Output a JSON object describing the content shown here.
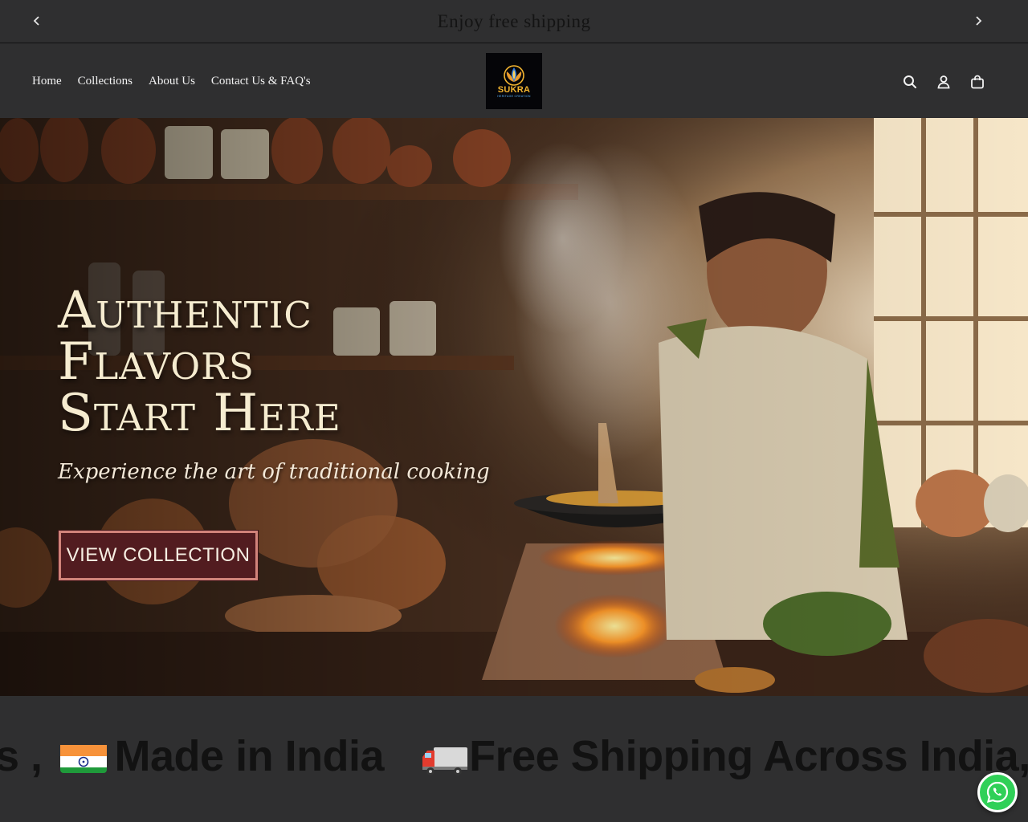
{
  "announcement": {
    "message": "Enjoy free shipping",
    "prev_icon": "chevron-left-icon",
    "next_icon": "chevron-right-icon"
  },
  "header": {
    "nav": [
      {
        "label": "Home"
      },
      {
        "label": "Collections"
      },
      {
        "label": "About Us"
      },
      {
        "label": "Contact Us & FAQ's"
      }
    ],
    "logo": {
      "brand": "SUKRA",
      "tagline": "HERITAGE CREATION"
    },
    "icons": [
      "search-icon",
      "account-icon",
      "cart-icon"
    ]
  },
  "hero": {
    "headline_line1": "Authentic",
    "headline_line2": "Flavors",
    "headline_line3": "Start Here",
    "subheadline": "Experience the art of traditional cooking",
    "cta_label": "VIEW COLLECTION"
  },
  "marquee": {
    "lead_text": "s ,",
    "item1": "Made in India",
    "item2": "Free Shipping Across India,"
  },
  "colors": {
    "page_bg": "#2f2f30",
    "cta_bg": "#521c20",
    "cta_border": "#d1837a",
    "whatsapp": "#2fd057"
  }
}
